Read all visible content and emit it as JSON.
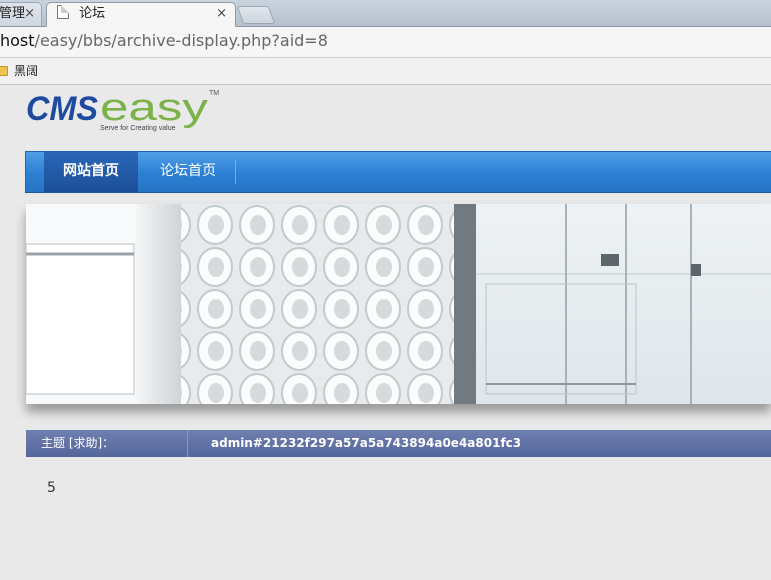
{
  "browser": {
    "tabs": [
      {
        "label": "管理",
        "close": "×"
      },
      {
        "label": "论坛",
        "close": "×"
      }
    ],
    "url": {
      "host": "host",
      "path": "/easy/bbs/archive-display.php?aid=8"
    },
    "bookmarks": [
      {
        "label": "黑阔"
      }
    ]
  },
  "site": {
    "logo": {
      "brand_left": "CMS",
      "brand_right": "easy",
      "tm": "TM",
      "tagline": "Serve for Creating value"
    },
    "nav": [
      {
        "label": "网站首页"
      },
      {
        "label": "论坛首页"
      }
    ]
  },
  "thread": {
    "label": "主题 [求助]：",
    "title": "admin#21232f297a57a5a743894a0e4a801fc3",
    "content": "5"
  },
  "colors": {
    "nav_blue": "#2b7fd3",
    "nav_active": "#1c4f98",
    "thread_bar": "#5d6ea3",
    "logo_blue": "#1e4aa0",
    "logo_green": "#7db24a"
  }
}
